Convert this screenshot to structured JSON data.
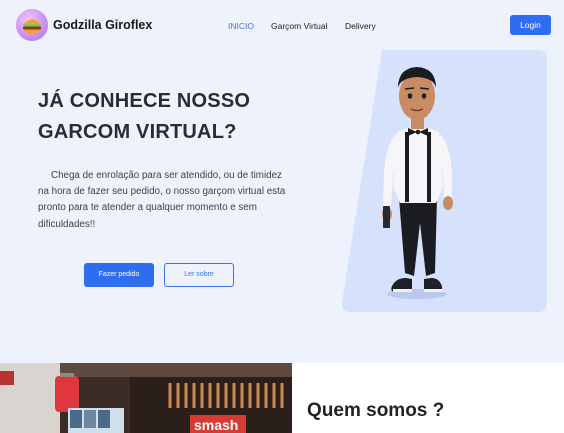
{
  "brand": {
    "name": "Godzilla Giroflex"
  },
  "nav": {
    "items": [
      {
        "label": "INICIO",
        "active": true
      },
      {
        "label": "Garçom Virtual",
        "active": false
      },
      {
        "label": "Delivery",
        "active": false
      }
    ],
    "login_label": "Login"
  },
  "hero": {
    "title_line1": "JÁ CONHECE NOSSO",
    "title_line2": "GARCOM VIRTUAL?",
    "description": "Chega de enrolação para ser atendido, ou de timidez na hora de fazer seu pedido, o nosso garçom virtual esta pronto para te atender a qualquer momento e sem dificuldades!!",
    "primary_button": "Fazer pedido",
    "secondary_button": "Ler sobre"
  },
  "about": {
    "title": "Quem somos ?",
    "photo_sign_text": "smash"
  },
  "colors": {
    "accent": "#2f6df0",
    "background": "#eef2fd",
    "panel": "#d6e2fc"
  },
  "icons": {
    "logo": "burger-logo-icon"
  }
}
